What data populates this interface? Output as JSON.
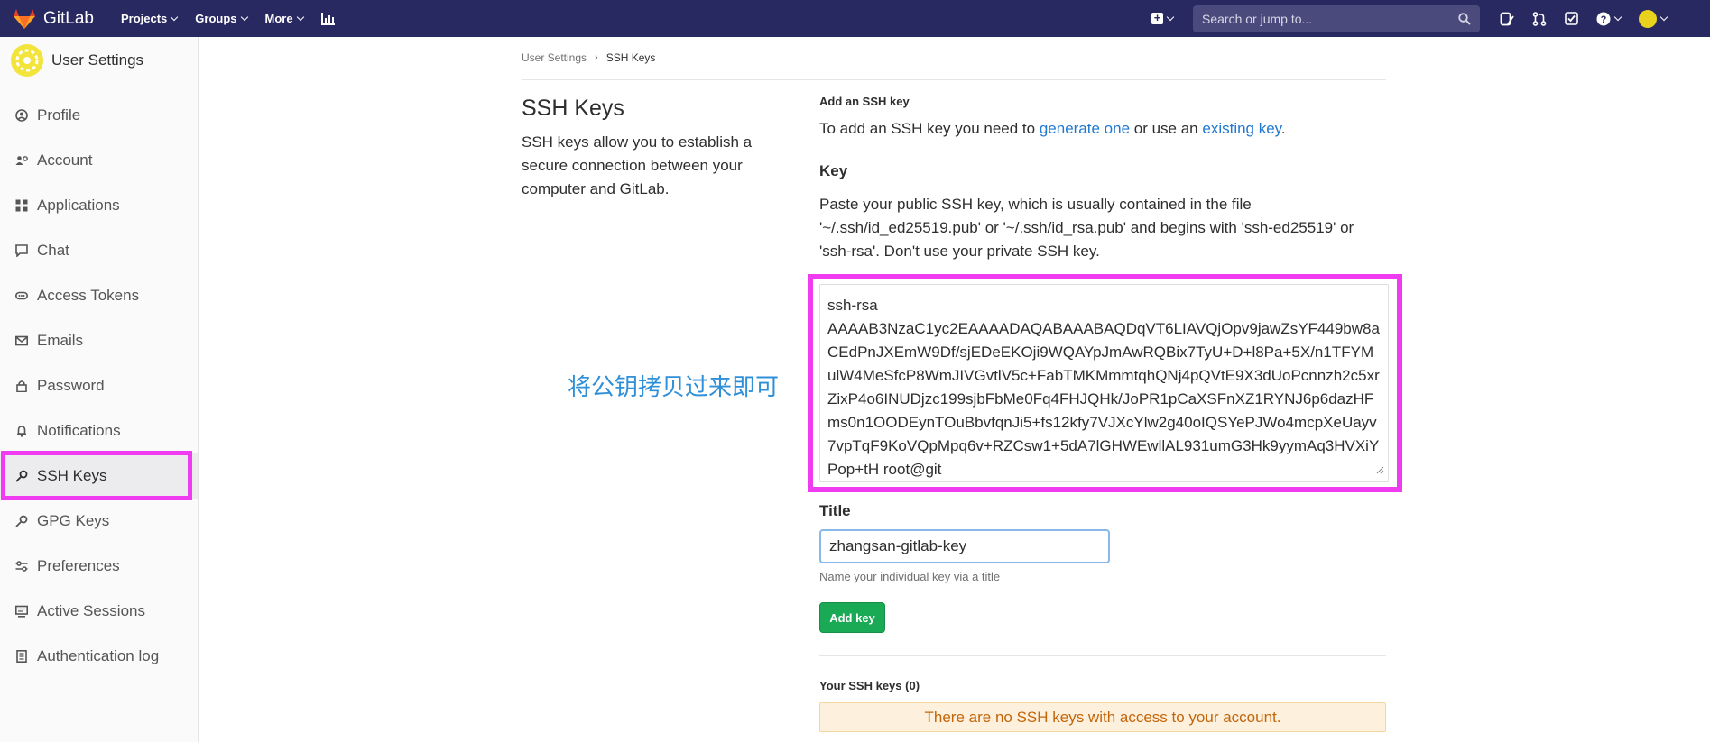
{
  "colors": {
    "navbar": "#292961",
    "accent_link": "#1f78d1",
    "highlight": "#f03cf0",
    "primary_button": "#1aaa55",
    "annotation": "#2f8fd8"
  },
  "navbar": {
    "brand": "GitLab",
    "menu": [
      {
        "label": "Projects",
        "icon": "chevron-down-icon"
      },
      {
        "label": "Groups",
        "icon": "chevron-down-icon"
      },
      {
        "label": "More",
        "icon": "chevron-down-icon"
      }
    ],
    "activity_icon": "chart-bars-icon",
    "search_placeholder": "Search or jump to...",
    "right_icons": [
      "new-item-icon",
      "issues-icon",
      "merge-requests-icon",
      "todos-icon",
      "help-icon",
      "user-avatar-icon"
    ]
  },
  "sidebar": {
    "title": "User Settings",
    "items": [
      {
        "label": "Profile",
        "icon": "profile-icon"
      },
      {
        "label": "Account",
        "icon": "account-icon"
      },
      {
        "label": "Applications",
        "icon": "applications-icon"
      },
      {
        "label": "Chat",
        "icon": "chat-icon"
      },
      {
        "label": "Access Tokens",
        "icon": "token-icon"
      },
      {
        "label": "Emails",
        "icon": "email-icon"
      },
      {
        "label": "Password",
        "icon": "lock-icon"
      },
      {
        "label": "Notifications",
        "icon": "bell-icon"
      },
      {
        "label": "SSH Keys",
        "icon": "key-icon",
        "active": true
      },
      {
        "label": "GPG Keys",
        "icon": "key-icon"
      },
      {
        "label": "Preferences",
        "icon": "preferences-icon"
      },
      {
        "label": "Active Sessions",
        "icon": "monitor-icon"
      },
      {
        "label": "Authentication log",
        "icon": "log-icon"
      }
    ]
  },
  "breadcrumb": {
    "parent": "User Settings",
    "current": "SSH Keys"
  },
  "intro": {
    "heading": "SSH Keys",
    "description": "SSH keys allow you to establish a secure connection between your computer and GitLab."
  },
  "form": {
    "section_heading": "Add an SSH key",
    "intro_prefix": "To add an SSH key you need to ",
    "intro_link1": "generate one",
    "intro_middle": " or use an ",
    "intro_link2": "existing key",
    "intro_suffix": ".",
    "key_label": "Key",
    "key_help": "Paste your public SSH key, which is usually contained in the file '~/.ssh/id_ed25519.pub' or '~/.ssh/id_rsa.pub' and begins with 'ssh-ed25519' or 'ssh-rsa'. Don't use your private SSH key.",
    "key_value": "ssh-rsa\nAAAAB3NzaC1yc2EAAAADAQABAAABAQDqVT6LIAVQjOpv9jawZsYF449bw8aCEdPnJXEmW9Df/sjEDeEKOji9WQAYpJmAwRQBix7TyU+D+l8Pa+5X/n1TFYMulW4MeSfcP8WmJIVGvtlV5c+FabTMKMmmtqhQNj4pQVtE9X3dUoPcnnzh2c5xrZixP4o6INUDjzc199sjbFbMe0Fq4FHJQHk/JoPR1pCaXSFnXZ1RYNJ6p6dazHFms0n1OODEynTOuBbvfqnJi5+fs12kfy7VJXcYlw2g40oIQSYePJWo4mcpXeUayv7vpTqF9KoVQpMpq6v+RZCsw1+5dA7lGHWEwllAL931umG3Hk9yymAq3HVXiYPop+tH root@git",
    "title_label": "Title",
    "title_value": "zhangsan-gitlab-key",
    "title_hint": "Name your individual key via a title",
    "submit_label": "Add key"
  },
  "keys_list": {
    "heading": "Your SSH keys (0)",
    "empty_message": "There are no SSH keys with access to your account."
  },
  "annotation_text": "将公钥拷贝过来即可"
}
